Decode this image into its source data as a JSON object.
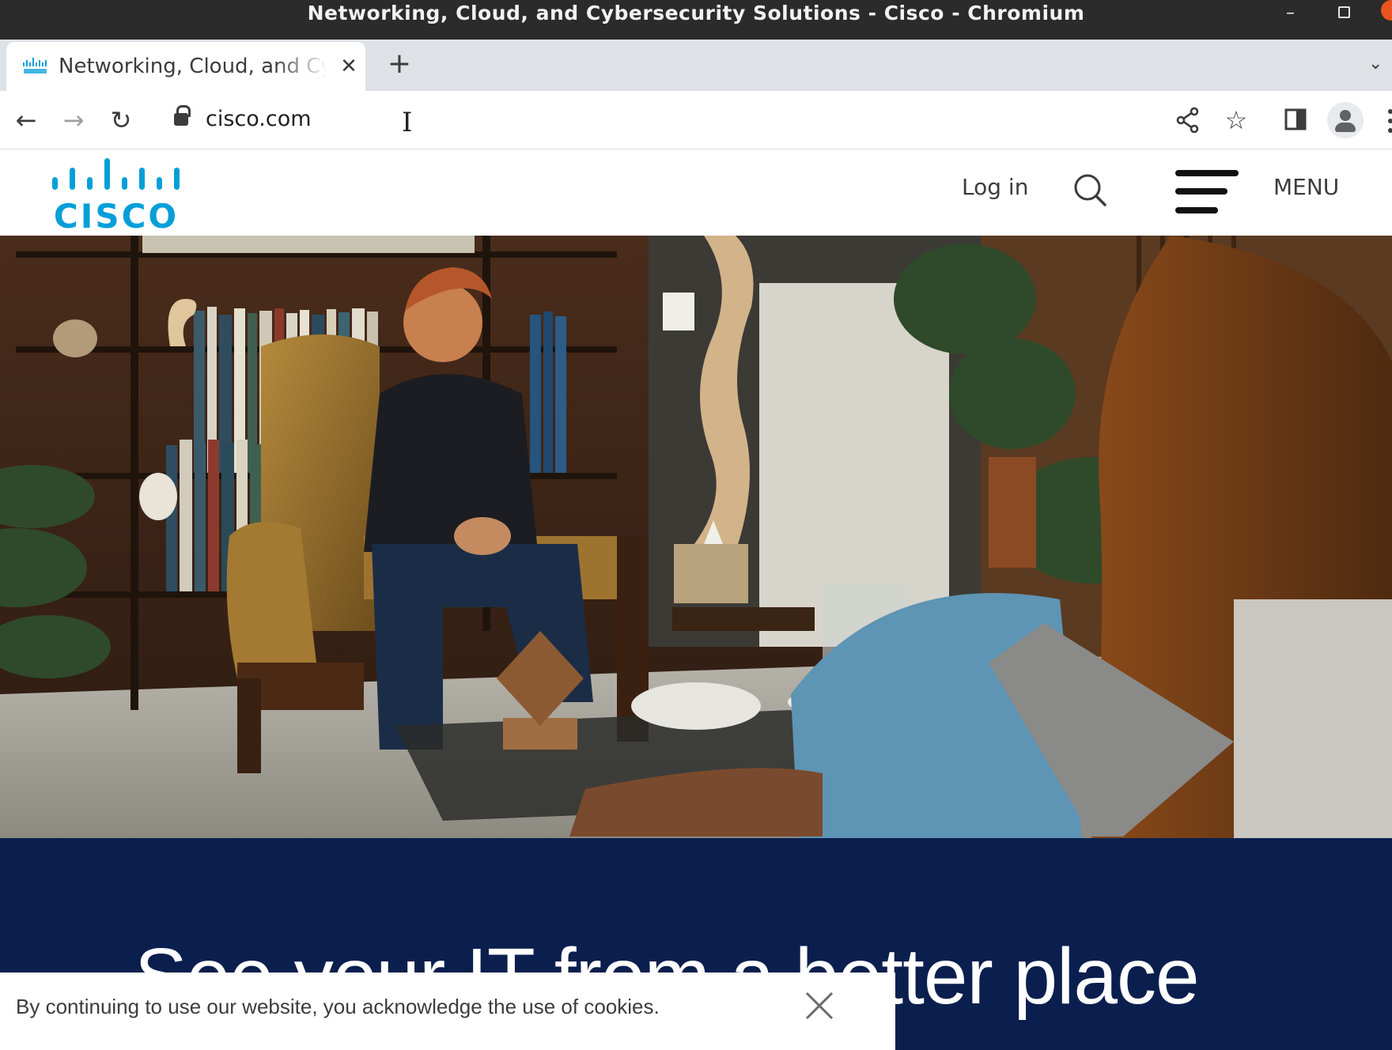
{
  "window": {
    "title": "Networking, Cloud, and Cybersecurity Solutions - Cisco - Chromium",
    "minimize_glyph": "–"
  },
  "tabs": [
    {
      "title": "Networking, Cloud, and Cybersecurity Solutions - Cisco",
      "favicon": "cisco-favicon",
      "active": true
    }
  ],
  "tab_controls": {
    "close_glyph": "✕",
    "new_tab_glyph": "+",
    "tab_search_glyph": "⌄"
  },
  "toolbar": {
    "back_glyph": "←",
    "forward_glyph": "→",
    "reload_glyph": "↻",
    "url": "cisco.com",
    "star_glyph": "☆",
    "cursor_glyph": "I"
  },
  "site": {
    "logo_text": "CISCO",
    "login_label": "Log in",
    "menu_label": "MENU"
  },
  "hero": {
    "headline": "See your IT from a better place"
  },
  "cookie_banner": {
    "message": "By continuing to use our website, you acknowledge the use of cookies."
  },
  "colors": {
    "cisco_blue": "#049fd9",
    "band_navy": "#0b1f4e",
    "titlebar": "#2b2b2b",
    "tabstrip": "#dee1e6",
    "ubuntu_close": "#e95420"
  }
}
